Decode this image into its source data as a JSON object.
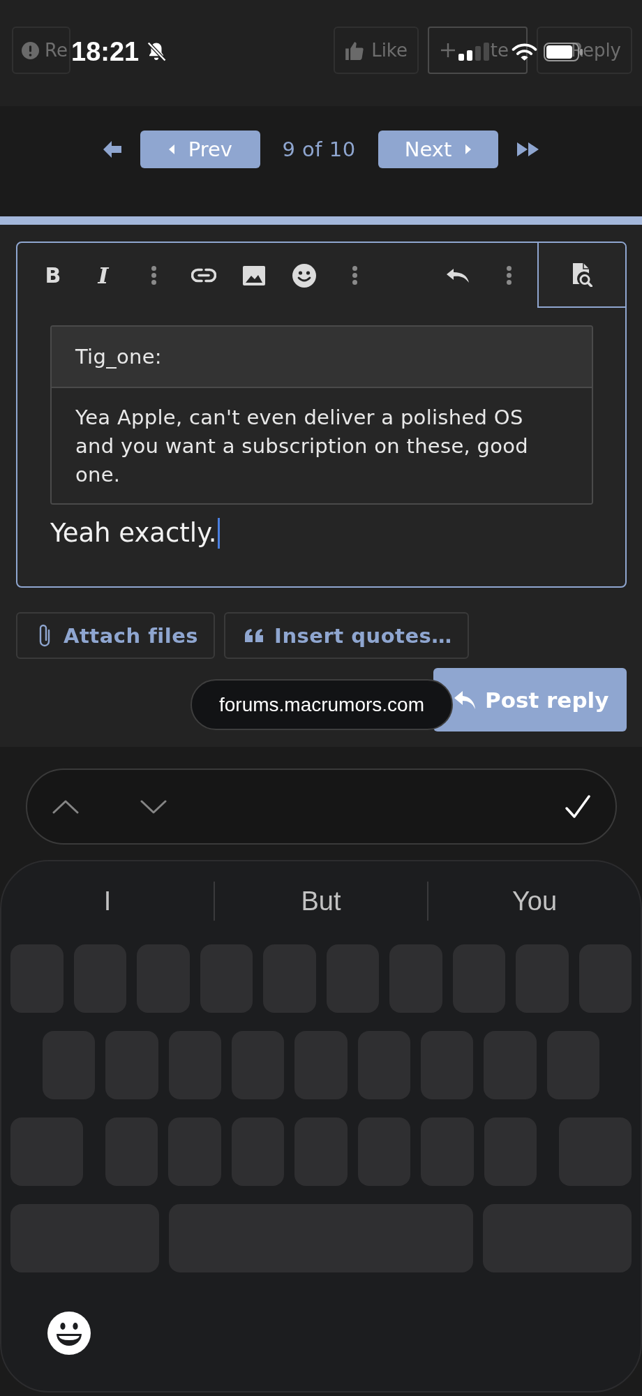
{
  "status_bar": {
    "time": "18:21"
  },
  "post_actions": [
    {
      "kind": "report",
      "label": "Re"
    },
    {
      "kind": "like",
      "label": "Like"
    },
    {
      "kind": "quote",
      "label": "te"
    },
    {
      "kind": "reply",
      "label": "Reply"
    }
  ],
  "pagination": {
    "previous": "Prev",
    "position": "9 of 10",
    "next": "Next"
  },
  "editor": {
    "toolbar": [
      {
        "kind": "bold",
        "label": "B"
      },
      {
        "kind": "italic",
        "label": "I"
      },
      {
        "kind": "more"
      },
      {
        "kind": "link"
      },
      {
        "kind": "image"
      },
      {
        "kind": "emoji"
      },
      {
        "kind": "more"
      },
      {
        "kind": "undo"
      },
      {
        "kind": "more"
      },
      {
        "kind": "preview"
      }
    ],
    "quote": {
      "author": "Tig_one:",
      "text": "Yea Apple, can't even deliver a polished OS and you want a subscription on these, good one."
    },
    "value": "Yeah exactly."
  },
  "actions": [
    {
      "kind": "attach",
      "label": "Attach files"
    },
    {
      "kind": "insert_quotes",
      "label": "Insert quotes…"
    }
  ],
  "submit": {
    "label": "Post reply"
  },
  "address_bar": {
    "url": "forums.macrumors.com"
  },
  "keyboard_toolbar": {
    "previous": {
      "disabled": true
    },
    "next": {
      "disabled": true
    }
  },
  "keyboard": {
    "suggestions": [
      "I",
      "But",
      "You"
    ]
  }
}
